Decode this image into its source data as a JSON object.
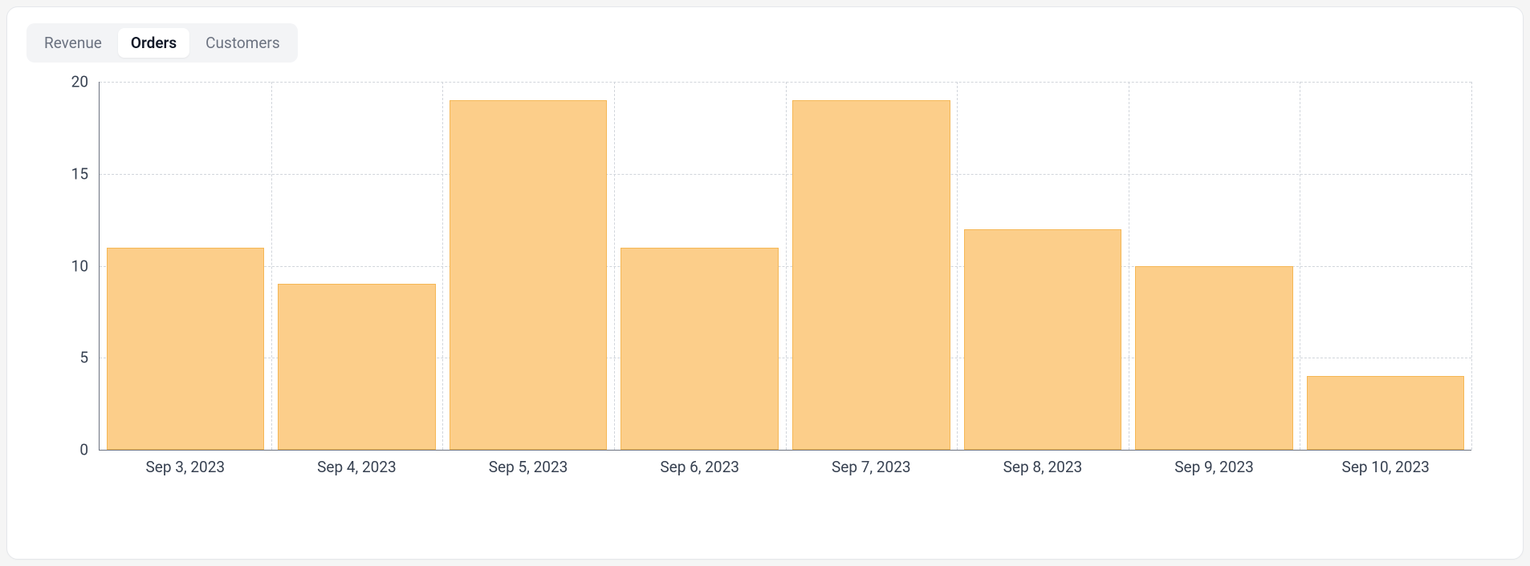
{
  "tabs": [
    {
      "label": "Revenue",
      "active": false
    },
    {
      "label": "Orders",
      "active": true
    },
    {
      "label": "Customers",
      "active": false
    }
  ],
  "chart_data": {
    "type": "bar",
    "title": "",
    "xlabel": "",
    "ylabel": "",
    "categories": [
      "Sep 3, 2023",
      "Sep 4, 2023",
      "Sep 5, 2023",
      "Sep 6, 2023",
      "Sep 7, 2023",
      "Sep 8, 2023",
      "Sep 9, 2023",
      "Sep 10, 2023"
    ],
    "values": [
      11,
      9,
      19,
      11,
      19,
      12,
      10,
      4
    ],
    "ylim": [
      0,
      20
    ],
    "yticks": [
      0,
      5,
      10,
      15,
      20
    ],
    "grid": true,
    "bar_color": "#fcce8a",
    "bar_border": "#f5b755"
  }
}
